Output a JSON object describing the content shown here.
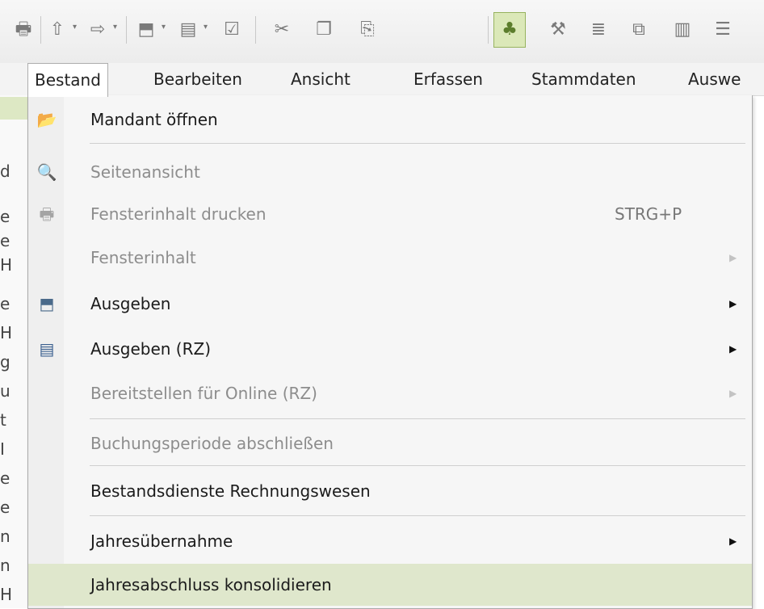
{
  "toolbar": {
    "icons": [
      "printer-icon",
      "arrow-up-icon",
      "arrow-right-icon",
      "export-icon",
      "export-rz-icon",
      "checklist-icon",
      "cut-icon",
      "copy-icon",
      "paste-icon",
      "tree-icon",
      "wrench-icon",
      "indent-icon",
      "window-icon",
      "document-icon",
      "list-icon"
    ]
  },
  "menubar": {
    "items": [
      "Bestand",
      "Bearbeiten",
      "Ansicht",
      "Erfassen",
      "Stammdaten",
      "Auswe"
    ]
  },
  "dropdown": {
    "items": [
      {
        "label": "Mandant öffnen"
      },
      {
        "label": "Seitenansicht"
      },
      {
        "label": "Fensterinhalt drucken",
        "shortcut": "STRG+P"
      },
      {
        "label": "Fensterinhalt"
      },
      {
        "label": "Ausgeben"
      },
      {
        "label": "Ausgeben (RZ)"
      },
      {
        "label": "Bereitstellen für Online (RZ)"
      },
      {
        "label": "Buchungsperiode abschließen"
      },
      {
        "label": "Bestandsdienste Rechnungswesen"
      },
      {
        "label": "Jahresübernahme"
      },
      {
        "label": "Jahresabschluss konsolidieren"
      }
    ]
  },
  "background_chars": [
    "d",
    "e",
    "e",
    "H",
    "e",
    "H",
    "g",
    "u",
    "t",
    "I",
    "e",
    "e",
    "n",
    "n",
    "H"
  ],
  "colors": {
    "highlight": "#dfe7cc",
    "active_tool": "#dbe8b8",
    "disabled_text": "#8d8d8d"
  }
}
